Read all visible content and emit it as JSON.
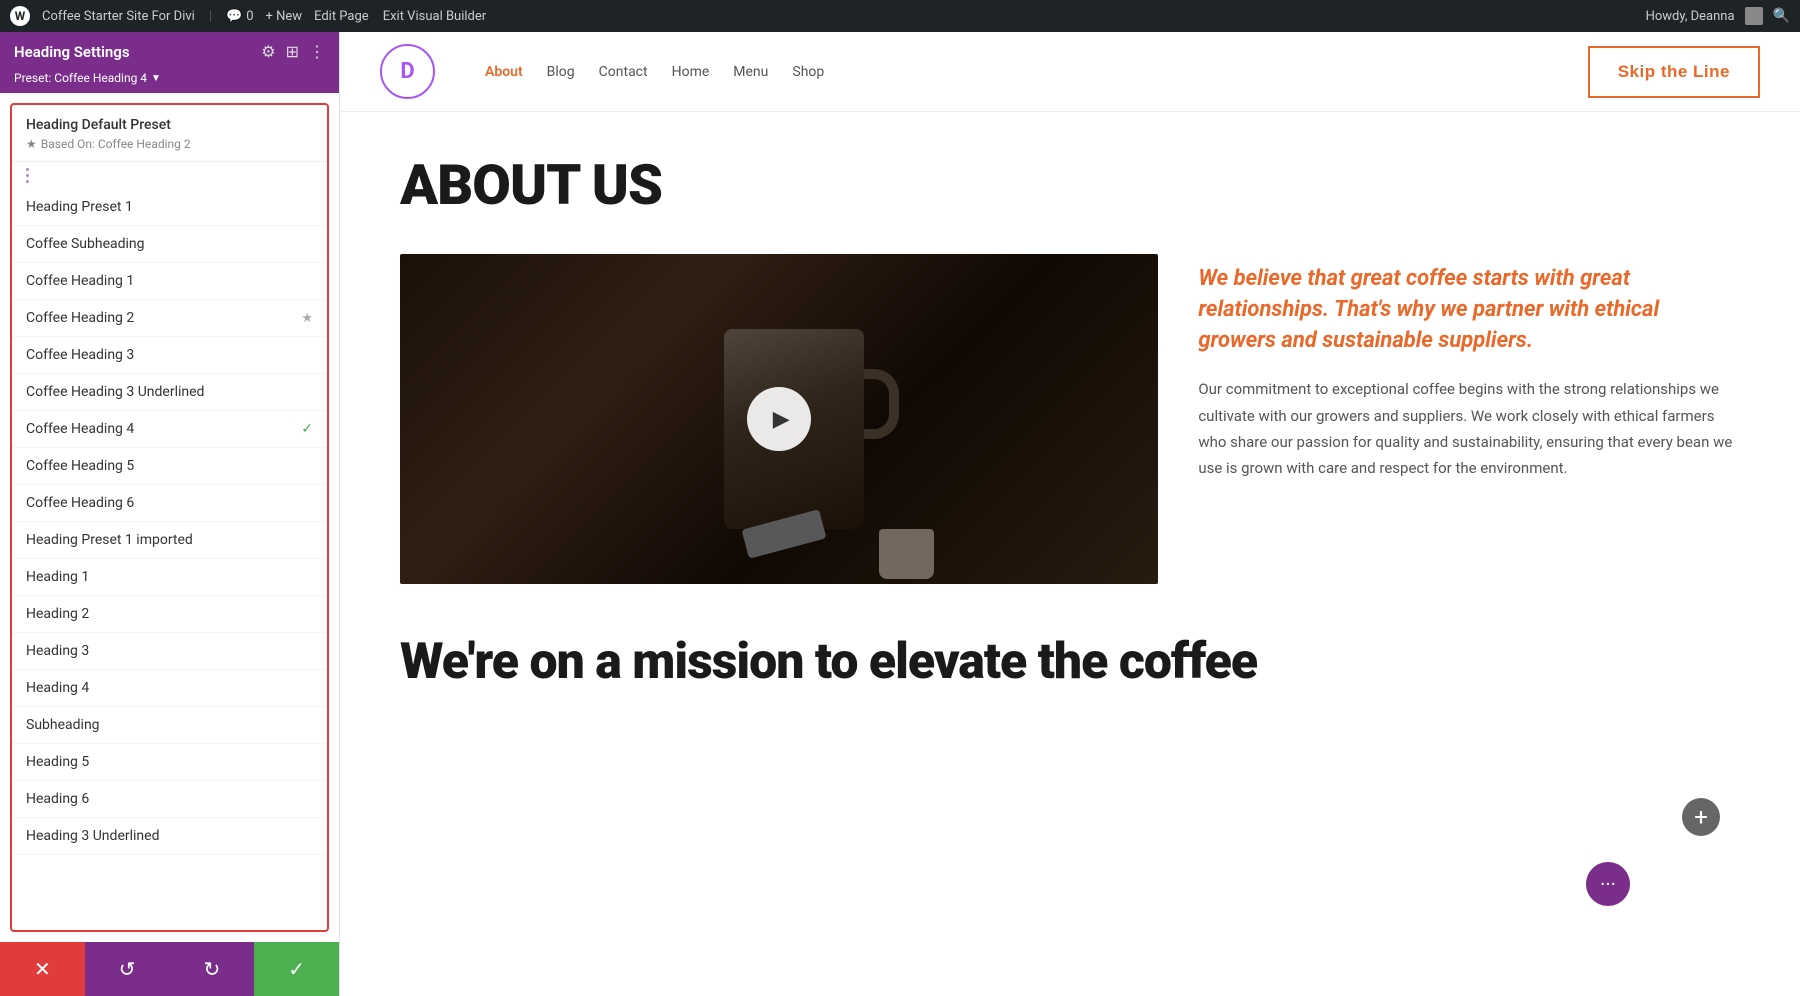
{
  "admin_bar": {
    "wp_label": "W",
    "site_name": "Coffee Starter Site For Divi",
    "comment_count": "0",
    "new_label": "+ New",
    "edit_page": "Edit Page",
    "exit_builder": "Exit Visual Builder",
    "howdy": "Howdy, Deanna"
  },
  "panel": {
    "title": "Heading Settings",
    "preset_label": "Preset: Coffee Heading 4",
    "default_preset": {
      "name": "Heading Default Preset",
      "based_on": "Based On: Coffee Heading 2"
    },
    "presets": [
      {
        "name": "Heading Preset 1",
        "star": false,
        "check": false
      },
      {
        "name": "Coffee Subheading",
        "star": false,
        "check": false
      },
      {
        "name": "Coffee Heading 1",
        "star": false,
        "check": false
      },
      {
        "name": "Coffee Heading 2",
        "star": true,
        "check": false
      },
      {
        "name": "Coffee Heading 3",
        "star": false,
        "check": false
      },
      {
        "name": "Coffee Heading 3 Underlined",
        "star": false,
        "check": false
      },
      {
        "name": "Coffee Heading 4",
        "star": false,
        "check": true
      },
      {
        "name": "Coffee Heading 5",
        "star": false,
        "check": false
      },
      {
        "name": "Coffee Heading 6",
        "star": false,
        "check": false
      },
      {
        "name": "Heading Preset 1 imported",
        "star": false,
        "check": false
      },
      {
        "name": "Heading 1",
        "star": false,
        "check": false
      },
      {
        "name": "Heading 2",
        "star": false,
        "check": false
      },
      {
        "name": "Heading 3",
        "star": false,
        "check": false
      },
      {
        "name": "Heading 4",
        "star": false,
        "check": false
      },
      {
        "name": "Subheading",
        "star": false,
        "check": false
      },
      {
        "name": "Heading 5",
        "star": false,
        "check": false
      },
      {
        "name": "Heading 6",
        "star": false,
        "check": false
      },
      {
        "name": "Heading 3 Underlined",
        "star": false,
        "check": false
      }
    ]
  },
  "toolbar": {
    "close_icon": "✕",
    "undo_icon": "↺",
    "redo_icon": "↻",
    "save_icon": "✓"
  },
  "site": {
    "logo_letter": "D",
    "nav_links": [
      "About",
      "Blog",
      "Contact",
      "Home",
      "Menu",
      "Shop"
    ],
    "active_nav": "About",
    "skip_btn": "Skip the Line"
  },
  "page": {
    "heading": "ABOUT US",
    "highlight_text": "We believe that great coffee starts with great relationships. That's why we partner with ethical growers and sustainable suppliers.",
    "body_text": "Our commitment to exceptional coffee begins with the strong relationships we cultivate with our growers and suppliers. We work closely with ethical farmers who share our passion for quality and sustainability, ensuring that every bean we use is grown with care and respect for the environment.",
    "mission_heading": "We're on a mission to elevate the coffee"
  },
  "colors": {
    "purple": "#7b2d8b",
    "orange": "#e8692a",
    "green": "#4caf50",
    "red": "#e03c3c"
  }
}
